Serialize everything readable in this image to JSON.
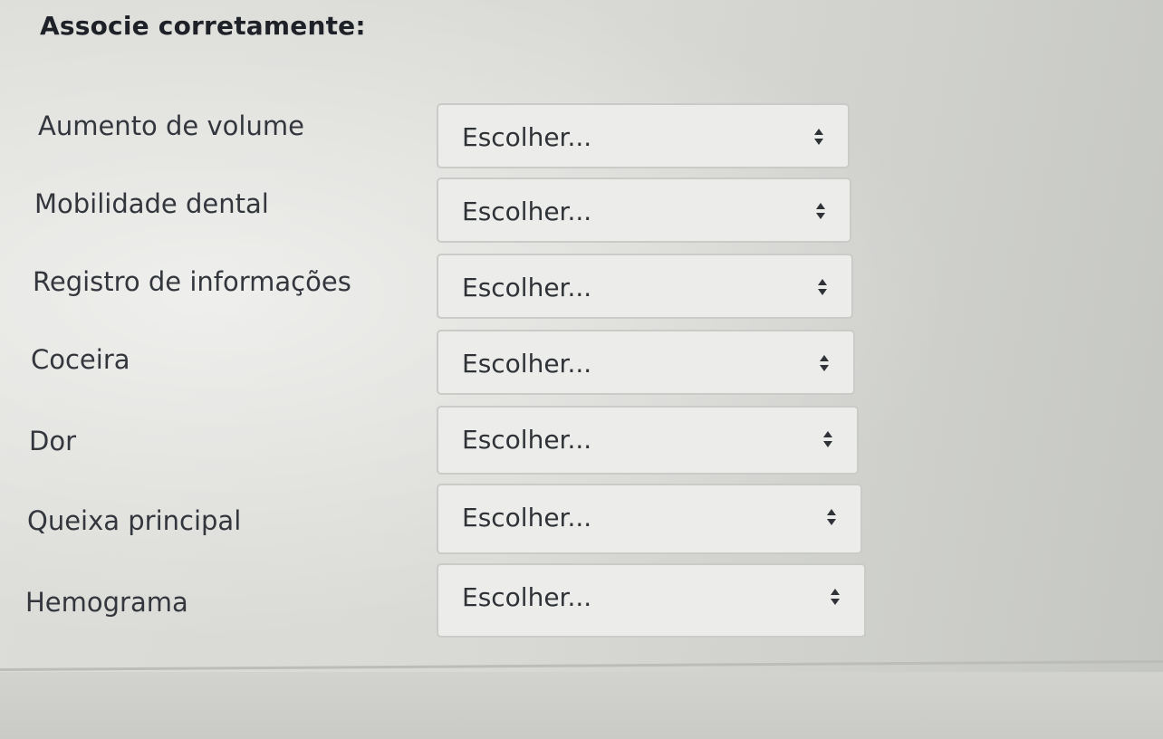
{
  "question": {
    "instruction": "Associe corretamente:"
  },
  "matching": {
    "rows": [
      {
        "label": "Aumento de volume",
        "selected": "Escolher..."
      },
      {
        "label": "Mobilidade dental",
        "selected": "Escolher..."
      },
      {
        "label": "Registro de informações",
        "selected": "Escolher..."
      },
      {
        "label": "Coceira",
        "selected": "Escolher..."
      },
      {
        "label": "Dor",
        "selected": "Escolher..."
      },
      {
        "label": "Queixa principal",
        "selected": "Escolher..."
      },
      {
        "label": "Hemograma",
        "selected": "Escolher..."
      }
    ]
  },
  "icons": {
    "dropdown": "chevron-up-down-icon"
  },
  "colors": {
    "background": "#d9d9d5",
    "select_background": "#ecedea",
    "select_border": "#c9cbc8",
    "text": "#2b2f36"
  }
}
